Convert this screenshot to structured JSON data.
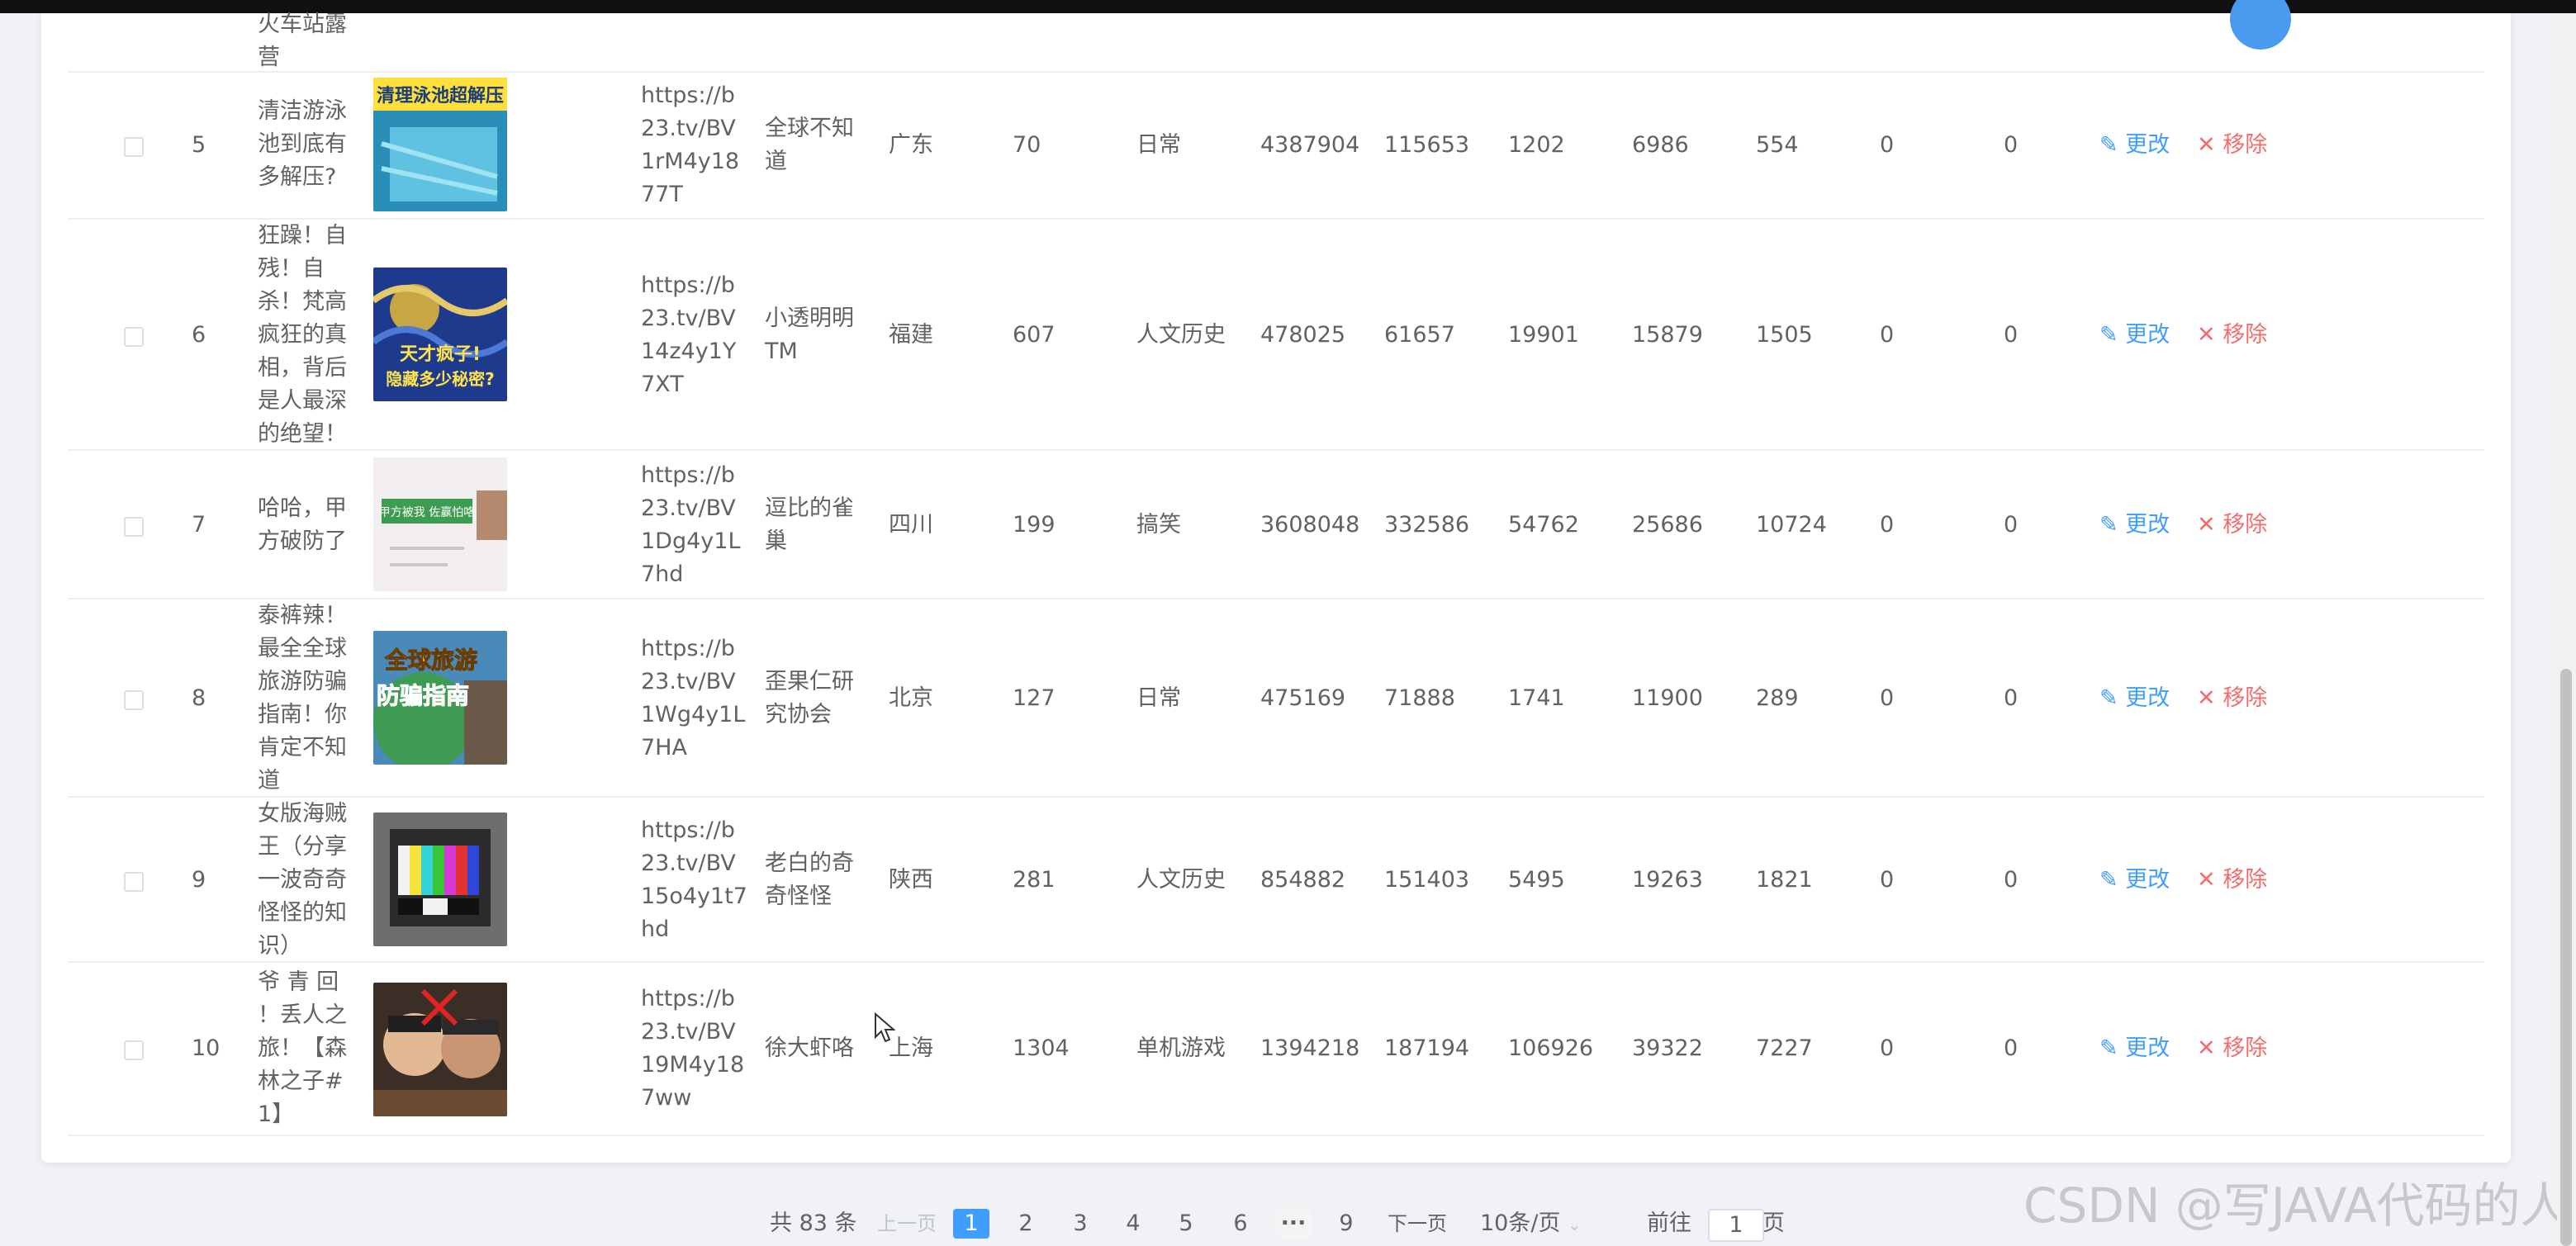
{
  "top_fragment": {
    "title_lines": [
      "火车站露",
      "营"
    ]
  },
  "rows": [
    {
      "index": "5",
      "title_lines": [
        "清洁游泳",
        "池到底有",
        "多解压?"
      ],
      "url_lines": [
        "https://b",
        "23.tv/BV",
        "1rM4y18",
        "77T"
      ],
      "author_lines": [
        "全球不知",
        "道"
      ],
      "province": "广东",
      "num1": "70",
      "category": "日常",
      "views": "4387904",
      "likes": "115653",
      "coins": "1202",
      "favs": "6986",
      "shares": "554",
      "zero1": "0",
      "zero2": "0",
      "thumb_text": [
        "清理泳池超解压"
      ],
      "edit_label": "更改",
      "delete_label": "移除"
    },
    {
      "index": "6",
      "title_lines": [
        "狂躁！自",
        "残！自",
        "杀！梵高",
        "疯狂的真",
        "相，背后",
        "是人最深",
        "的绝望！"
      ],
      "url_lines": [
        "https://b",
        "23.tv/BV",
        "14z4y1Y",
        "7XT"
      ],
      "author_lines": [
        "小透明明",
        "TM"
      ],
      "province": "福建",
      "num1": "607",
      "category": "人文历史",
      "views": "478025",
      "likes": "61657",
      "coins": "19901",
      "favs": "15879",
      "shares": "1505",
      "zero1": "0",
      "zero2": "0",
      "thumb_text": [
        "天才疯子!",
        "隐藏多少秘密?"
      ],
      "edit_label": "更改",
      "delete_label": "移除"
    },
    {
      "index": "7",
      "title_lines": [
        "哈哈，甲",
        "方破防了"
      ],
      "url_lines": [
        "https://b",
        "23.tv/BV",
        "1Dg4y1L",
        "7hd"
      ],
      "author_lines": [
        "逗比的雀",
        "巢"
      ],
      "province": "四川",
      "num1": "199",
      "category": "搞笑",
      "views": "3608048",
      "likes": "332586",
      "coins": "54762",
      "favs": "25686",
      "shares": "10724",
      "zero1": "0",
      "zero2": "0",
      "thumb_text": [
        "甲方被我 佐赢怕咯"
      ],
      "edit_label": "更改",
      "delete_label": "移除"
    },
    {
      "index": "8",
      "title_lines": [
        "泰裤辣！",
        "最全全球",
        "旅游防骗",
        "指南！你",
        "肯定不知",
        "道"
      ],
      "url_lines": [
        "https://b",
        "23.tv/BV",
        "1Wg4y1L",
        "7HA"
      ],
      "author_lines": [
        "歪果仁研",
        "究协会"
      ],
      "province": "北京",
      "num1": "127",
      "category": "日常",
      "views": "475169",
      "likes": "71888",
      "coins": "1741",
      "favs": "11900",
      "shares": "289",
      "zero1": "0",
      "zero2": "0",
      "thumb_text": [
        "全球旅游",
        "防骗指南"
      ],
      "edit_label": "更改",
      "delete_label": "移除"
    },
    {
      "index": "9",
      "title_lines": [
        "女版海贼",
        "王（分享",
        "一波奇奇",
        "怪怪的知",
        "识）"
      ],
      "url_lines": [
        "https://b",
        "23.tv/BV",
        "15o4y1t7",
        "hd"
      ],
      "author_lines": [
        "老白的奇",
        "奇怪怪"
      ],
      "province": "陕西",
      "num1": "281",
      "category": "人文历史",
      "views": "854882",
      "likes": "151403",
      "coins": "5495",
      "favs": "19263",
      "shares": "1821",
      "zero1": "0",
      "zero2": "0",
      "thumb_text": [],
      "edit_label": "更改",
      "delete_label": "移除"
    },
    {
      "index": "10",
      "title_lines": [
        "爷 青 回",
        "！丢人之",
        "旅！【森",
        "林之子#",
        "1】"
      ],
      "url_lines": [
        "https://b",
        "23.tv/BV",
        "19M4y18",
        "7ww"
      ],
      "author_lines": [
        "徐大虾咯"
      ],
      "province": "上海",
      "num1": "1304",
      "category": "单机游戏",
      "views": "1394218",
      "likes": "187194",
      "coins": "106926",
      "favs": "39322",
      "shares": "7227",
      "zero1": "0",
      "zero2": "0",
      "thumb_text": [],
      "edit_label": "更改",
      "delete_label": "移除"
    }
  ],
  "pagination": {
    "total": "共 83 条",
    "prev": "上一页",
    "pages": [
      "1",
      "2",
      "3",
      "4",
      "5",
      "6",
      "···",
      "9"
    ],
    "active_page": "1",
    "next": "下一页",
    "page_size": "10条/页",
    "goto_label": "前往",
    "goto_value": "1",
    "goto_suffix": "页"
  },
  "watermark": "CSDN @写JAVA代码的人",
  "colors": {
    "accent": "#409eff",
    "danger": "#f56c6c",
    "text": "#606266",
    "border": "#ebeef5"
  }
}
